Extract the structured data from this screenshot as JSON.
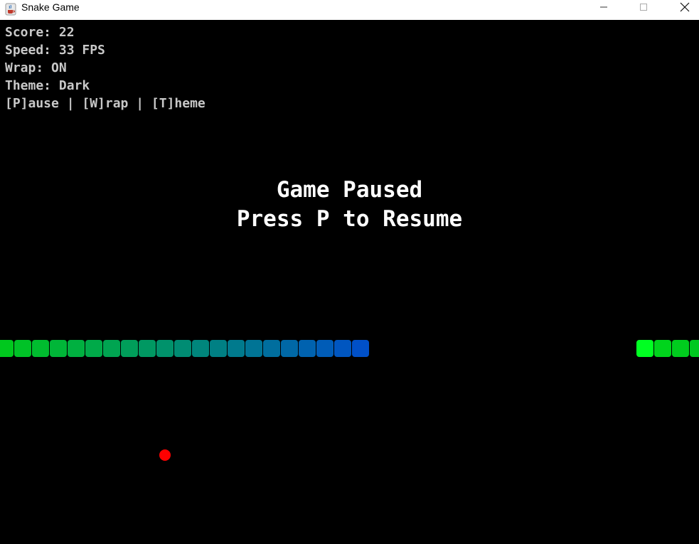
{
  "window": {
    "title": "Snake Game",
    "icon": "java-coffee-icon"
  },
  "controls": {
    "minimize_icon": "minimize-icon",
    "maximize_icon": "maximize-icon",
    "close_icon": "close-icon"
  },
  "hud": {
    "score": "Score: 22",
    "speed": "Speed: 33 FPS",
    "wrap": "Wrap: ON",
    "theme": "Theme: Dark",
    "keys": "[P]ause | [W]rap | [T]heme"
  },
  "overlay": {
    "line1": "Game Paused",
    "line2": "Press P to Resume"
  },
  "colors": {
    "background": "#000000",
    "hud_text": "#c8c8c8",
    "overlay_text": "#ffffff",
    "food": "#ff0000",
    "snake_head": "#00ff22",
    "snake_gradient_start": "#00c81e",
    "snake_gradient_end": "#0050c8"
  }
}
